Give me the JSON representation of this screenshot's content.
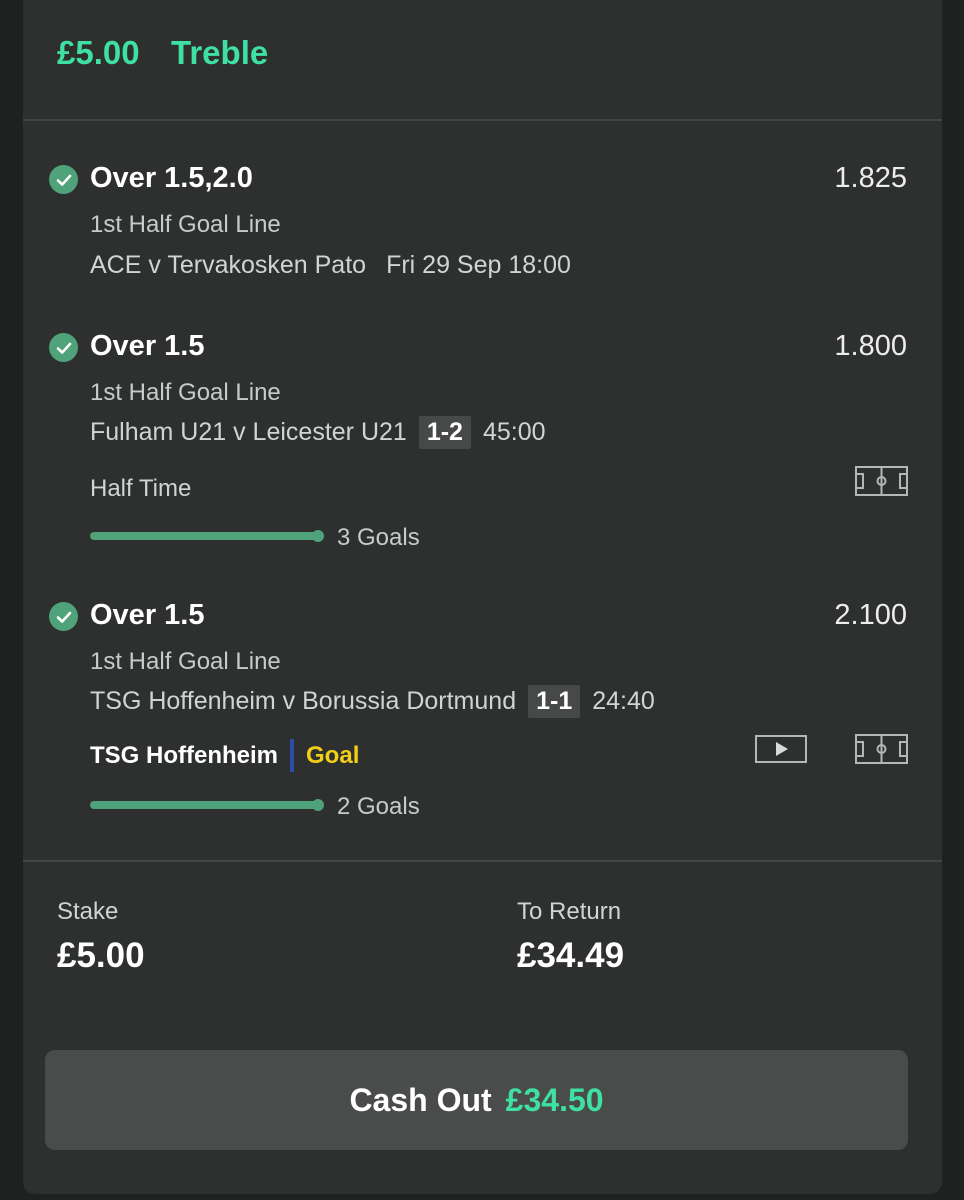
{
  "header": {
    "amount": "£5.00",
    "bet_type": "Treble"
  },
  "selections": [
    {
      "title": "Over 1.5,2.0",
      "odds": "1.825",
      "market": "1st Half Goal Line",
      "event": "ACE v Tervakosken Pato",
      "time": "Fri 29 Sep 18:00"
    },
    {
      "title": "Over 1.5",
      "odds": "1.800",
      "market": "1st Half Goal Line",
      "event": "Fulham U21 v Leicester U21",
      "score": "1-2",
      "clock": "45:00",
      "status": "Half Time",
      "goals": "3 Goals",
      "goals_progress": 1.0
    },
    {
      "title": "Over 1.5",
      "odds": "2.100",
      "market": "1st Half Goal Line",
      "event": "TSG Hoffenheim v Borussia Dortmund",
      "score": "1-1",
      "clock": "24:40",
      "last_event_team": "TSG Hoffenheim",
      "last_event": "Goal",
      "goals": "2 Goals",
      "goals_progress": 1.0
    }
  ],
  "footer": {
    "stake_label": "Stake",
    "stake_value": "£5.00",
    "return_label": "To Return",
    "return_value": "£34.49"
  },
  "cashout": {
    "label": "Cash Out",
    "amount": "£34.50"
  },
  "colors": {
    "accent_green": "#3ee0a3",
    "check_green": "#4fa27a",
    "goal_yellow": "#f2cf17",
    "home_team_bar": "#2a4ea8"
  },
  "icons": [
    "check-icon",
    "pitch-icon",
    "video-icon"
  ]
}
